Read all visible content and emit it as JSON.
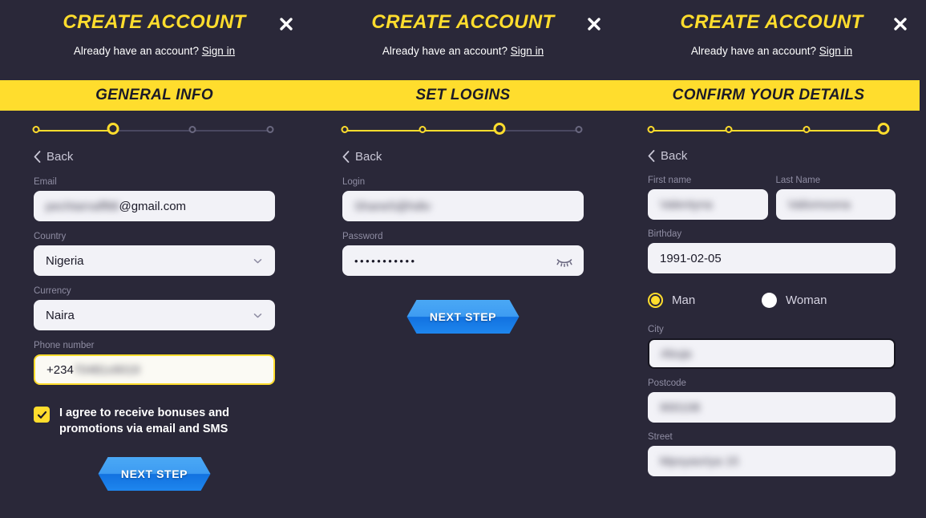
{
  "dialog": {
    "title": "CREATE ACCOUNT",
    "signin_prompt": "Already have an account?",
    "signin_link": "Sign in",
    "close_icon": "close-icon",
    "back_label": "Back"
  },
  "theme": {
    "background": "#2a2839",
    "accent_yellow": "#FFDD2D",
    "button_blue": "#1e86ee",
    "input_bg": "#f2f2f7"
  },
  "panels": [
    {
      "step_title": "GENERAL INFO",
      "progress": {
        "total": 4,
        "completed": 1,
        "current": 2
      },
      "fields": [
        {
          "label": "Email",
          "value": "@gmail.com",
          "masked_prefix": "pechtarnaff88",
          "type": "text"
        },
        {
          "label": "Country",
          "value": "Nigeria",
          "type": "select"
        },
        {
          "label": "Currency",
          "value": "Naira",
          "type": "select"
        },
        {
          "label": "Phone number",
          "value": "+234",
          "masked_suffix": "70481x9019",
          "type": "tel",
          "highlighted": true
        }
      ],
      "checkbox": {
        "checked": true,
        "label_line1": "I agree to receive bonuses and",
        "label_line2": "promotions via email and SMS"
      },
      "next_button": "NEXT STEP"
    },
    {
      "step_title": "SET LOGINS",
      "progress": {
        "total": 4,
        "completed": 2,
        "current": 3
      },
      "fields": [
        {
          "label": "Login",
          "value": "",
          "masked_value": "Shane5@hdtv",
          "type": "text"
        },
        {
          "label": "Password",
          "value": "•••••••••••",
          "type": "password",
          "reveal_icon": "eye-closed-icon"
        }
      ],
      "next_button": "NEXT STEP"
    },
    {
      "step_title": "CONFIRM YOUR DETAILS",
      "progress": {
        "total": 4,
        "completed": 3,
        "current": 4
      },
      "fields": [
        {
          "label": "First name",
          "value": "",
          "masked_value": "Valentyna",
          "type": "text"
        },
        {
          "label": "Last Name",
          "value": "",
          "masked_value": "Valiomoona",
          "type": "text"
        },
        {
          "label": "Birthday",
          "value": "1991-02-05",
          "type": "date"
        },
        {
          "label": "City",
          "value": "",
          "masked_value": "Abuja",
          "type": "text",
          "bordered": true
        },
        {
          "label": "Postcode",
          "value": "",
          "masked_value": "900108",
          "type": "text"
        },
        {
          "label": "Street",
          "value": "",
          "masked_value": "Mpoyaoriya 15",
          "type": "text"
        }
      ],
      "gender": {
        "options": [
          {
            "label": "Man",
            "selected": true
          },
          {
            "label": "Woman",
            "selected": false
          }
        ]
      }
    }
  ]
}
